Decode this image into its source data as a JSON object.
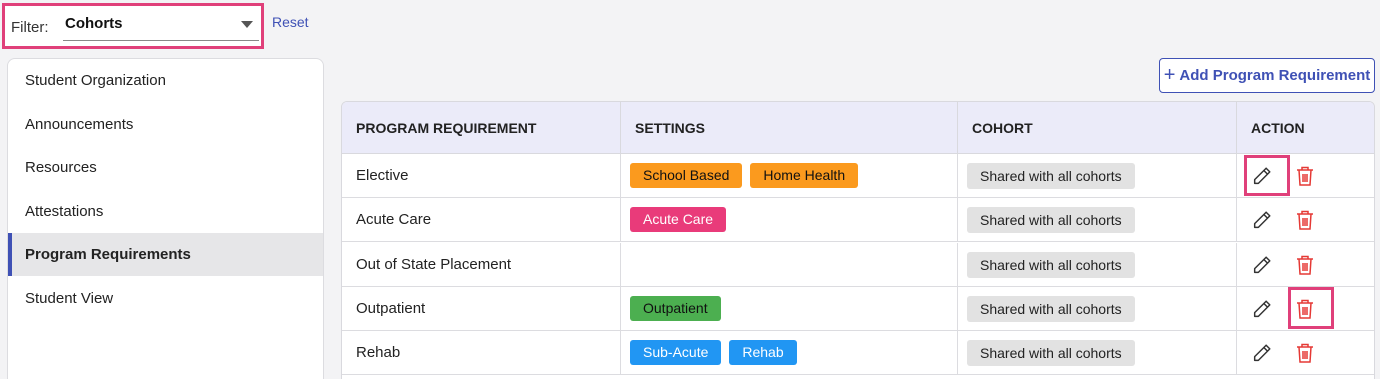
{
  "filter": {
    "label": "Filter:",
    "value": "Cohorts",
    "reset_label": "Reset"
  },
  "sidebar": {
    "items": [
      {
        "label": "Student Organization",
        "active": false
      },
      {
        "label": "Announcements",
        "active": false
      },
      {
        "label": "Resources",
        "active": false
      },
      {
        "label": "Attestations",
        "active": false
      },
      {
        "label": "Program Requirements",
        "active": true
      },
      {
        "label": "Student View",
        "active": false
      }
    ]
  },
  "toolbar": {
    "add_label": "Add Program Requirement",
    "add_icon": "plus-icon"
  },
  "table": {
    "headers": [
      "PROGRAM REQUIREMENT",
      "SETTINGS",
      "COHORT",
      "ACTION"
    ],
    "rows": [
      {
        "name": "Elective",
        "settings": [
          {
            "label": "School Based",
            "color": "orange"
          },
          {
            "label": "Home Health",
            "color": "orange"
          }
        ],
        "cohort": "Shared with all cohorts"
      },
      {
        "name": "Acute Care",
        "settings": [
          {
            "label": "Acute Care",
            "color": "pink"
          }
        ],
        "cohort": "Shared with all cohorts"
      },
      {
        "name": "Out of State Placement",
        "settings": [],
        "cohort": "Shared with all cohorts"
      },
      {
        "name": "Outpatient",
        "settings": [
          {
            "label": "Outpatient",
            "color": "green"
          }
        ],
        "cohort": "Shared with all cohorts"
      },
      {
        "name": "Rehab",
        "settings": [
          {
            "label": "Sub-Acute",
            "color": "blue"
          },
          {
            "label": "Rehab",
            "color": "blue"
          }
        ],
        "cohort": "Shared with all cohorts"
      }
    ],
    "action_icons": [
      "pencil-icon",
      "trash-icon"
    ]
  },
  "colors": {
    "accent": "#3f51b5",
    "highlight": "#e0407a",
    "tag_orange": "#fb9a1e",
    "tag_pink": "#e93b7a",
    "tag_green": "#4caf50",
    "tag_blue": "#2196f3",
    "delete_red": "#e53935"
  }
}
